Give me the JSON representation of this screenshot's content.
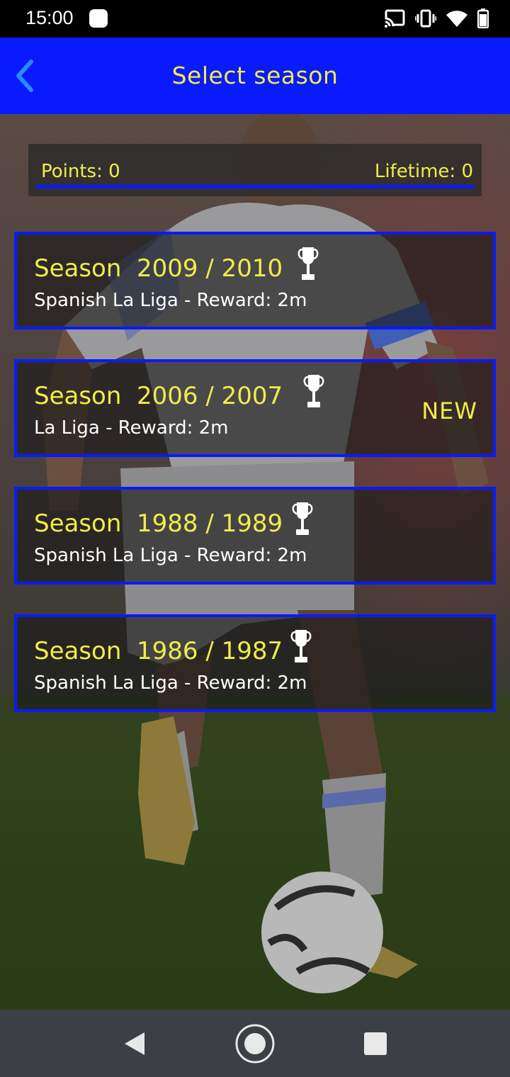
{
  "status_bar": {
    "time": "15:00",
    "icons": [
      "cast-icon",
      "vibrate-icon",
      "wifi-icon",
      "battery-icon"
    ]
  },
  "app_bar": {
    "title": "Select season",
    "back_icon": "chevron-left-icon"
  },
  "points": {
    "points_label": "Points: 0",
    "lifetime_label": "Lifetime: 0"
  },
  "seasons": [
    {
      "title": "Season  2009 / 2010",
      "subtitle": "Spanish La Liga - Reward: 2m",
      "badge": ""
    },
    {
      "title": "Season  2006 / 2007",
      "subtitle": "La Liga - Reward: 2m",
      "badge": "NEW"
    },
    {
      "title": "Season  1988 / 1989",
      "subtitle": "Spanish La Liga - Reward: 2m",
      "badge": ""
    },
    {
      "title": "Season  1986 / 1987",
      "subtitle": "Spanish La Liga - Reward: 2m",
      "badge": ""
    }
  ],
  "colors": {
    "accent_blue": "#0a1aff",
    "text_yellow": "#f1ec4a",
    "nav_bar": "#3c3f43"
  },
  "nav_bar": {
    "icons": [
      "nav-back-icon",
      "nav-home-icon",
      "nav-recents-icon"
    ]
  }
}
